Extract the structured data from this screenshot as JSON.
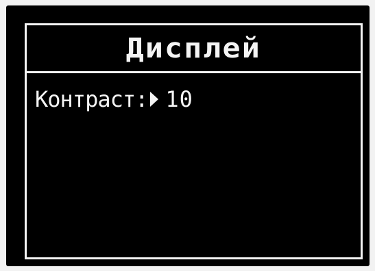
{
  "screen": {
    "title": "Дисплей"
  },
  "menu": {
    "items": [
      {
        "label": "Контраст:",
        "value": "10",
        "pointer_icon": "triangle-right-icon"
      }
    ]
  },
  "colors": {
    "background": "#000000",
    "foreground": "#f4f4f4"
  }
}
